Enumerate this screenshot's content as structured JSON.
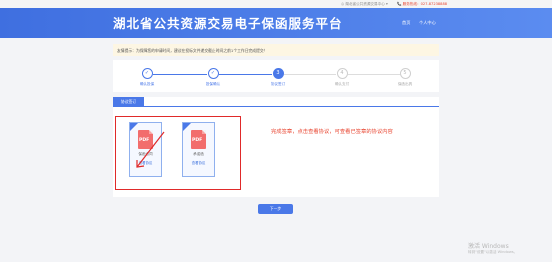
{
  "topbar": {
    "region": "◎ 湖北省公共资源交易中心 ▾",
    "hotline": "📞 服务热线：027-87238888"
  },
  "header": {
    "title": "湖北省公共资源交易电子保函服务平台",
    "nav_home": "首页",
    "nav_user": "个人中心"
  },
  "notice": "友情提示：为保障您的申请时间，建议在投标文件递交截止时间之前1个工作日完成提交！",
  "steps": [
    {
      "icon": "✓",
      "label": "确认投保"
    },
    {
      "icon": "✓",
      "label": "投保确认"
    },
    {
      "icon": "3",
      "label": "协议签订"
    },
    {
      "icon": "4",
      "label": "确认支付"
    },
    {
      "icon": "5",
      "label": "保函出具"
    }
  ],
  "tab_label": "协议签订",
  "cards": [
    {
      "pdf": "PDF",
      "name": "保函合同",
      "view": "查看协议"
    },
    {
      "pdf": "PDF",
      "name": "承诺函",
      "view": "查看协议"
    }
  ],
  "annotation": "完成签章，点击查看协议，可查看已签章的协议内容",
  "next_button": "下一步",
  "watermark": {
    "line1": "激活 Windows",
    "line2": "转到\"设置\"以激活 Windows。"
  },
  "colors": {
    "primary": "#4a78e8",
    "annotation_red": "#e02a2a",
    "notice_bg": "#fdf6e3"
  }
}
